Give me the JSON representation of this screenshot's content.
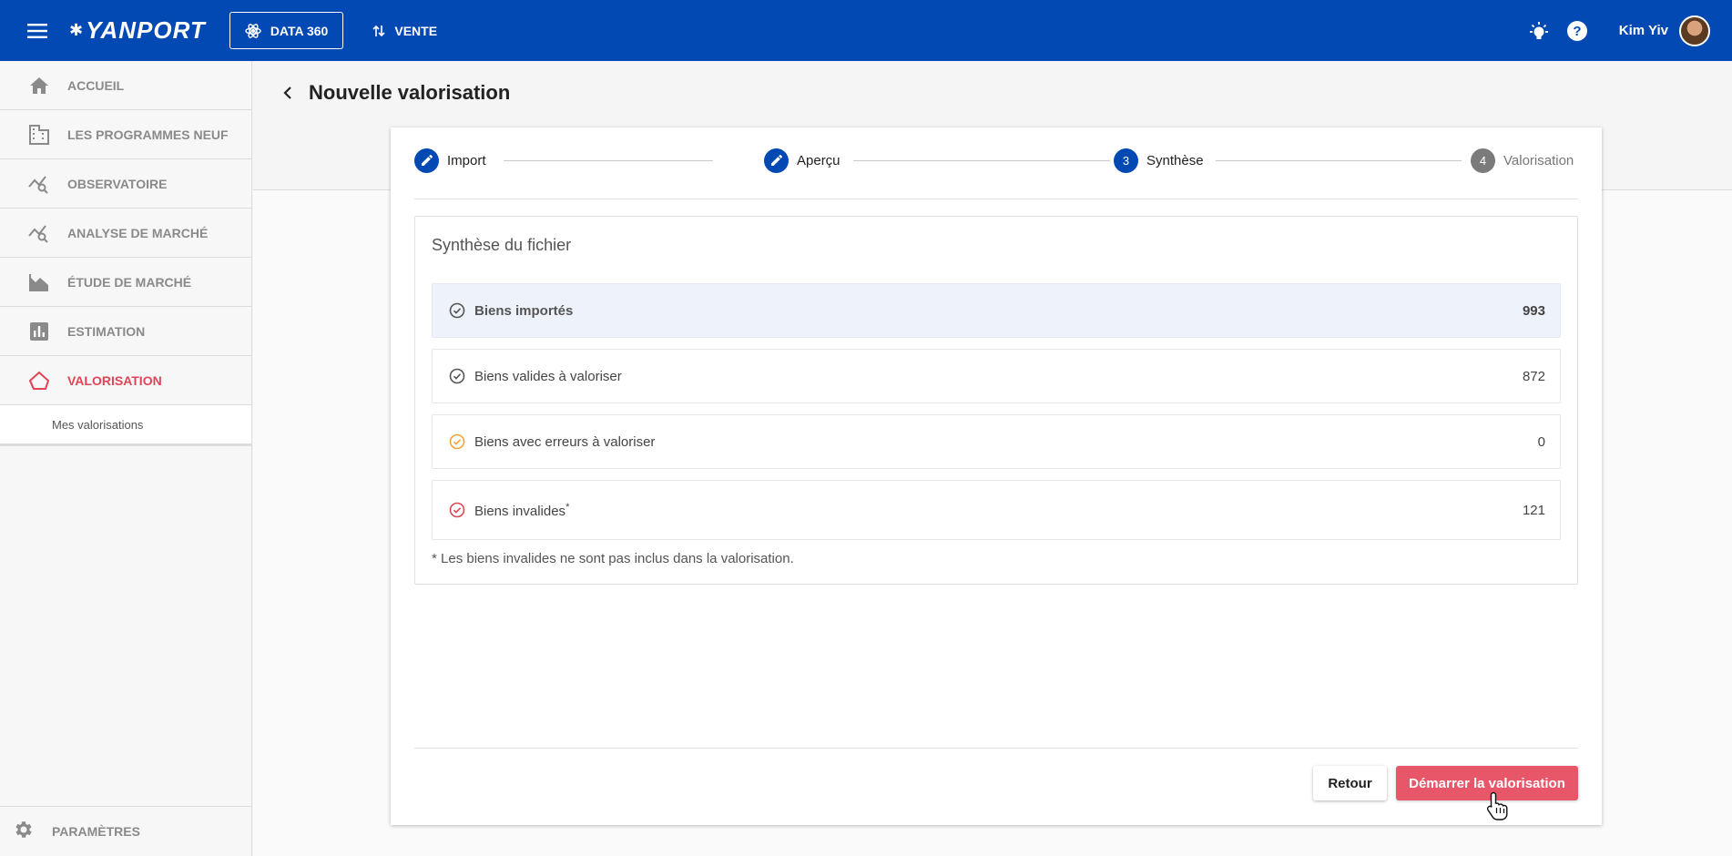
{
  "topbar": {
    "logo_text": "YANPORT",
    "data360_label": "DATA 360",
    "vente_label": "VENTE",
    "user_name": "Kim Yiv",
    "bg_color": "#0349b4"
  },
  "sidebar": {
    "items": [
      {
        "label": "ACCUEIL",
        "icon": "home-icon"
      },
      {
        "label": "LES PROGRAMMES NEUF",
        "icon": "building-icon"
      },
      {
        "label": "OBSERVATOIRE",
        "icon": "chart-search-icon"
      },
      {
        "label": "ANALYSE DE MARCHÉ",
        "icon": "chart-search-icon"
      },
      {
        "label": "ÉTUDE DE MARCHÉ",
        "icon": "area-chart-icon"
      },
      {
        "label": "ESTIMATION",
        "icon": "bar-chart-icon"
      },
      {
        "label": "VALORISATION",
        "icon": "house-outline-icon"
      }
    ],
    "sub_item": "Mes valorisations",
    "params_label": "PARAMÈTRES",
    "active_color": "#e04556"
  },
  "page": {
    "title": "Nouvelle valorisation"
  },
  "stepper": {
    "steps": [
      {
        "label": "Import",
        "marker": "pencil-icon"
      },
      {
        "label": "Aperçu",
        "marker": "pencil-icon"
      },
      {
        "label": "Synthèse",
        "marker": "3"
      },
      {
        "label": "Valorisation",
        "marker": "4"
      }
    ]
  },
  "synthese": {
    "title": "Synthèse du fichier",
    "rows": [
      {
        "label": "Biens importés",
        "value": "993",
        "icon": "check-circle-icon",
        "icon_color": "#555555"
      },
      {
        "label": "Biens valides à valoriser",
        "value": "872",
        "icon": "check-circle-icon",
        "icon_color": "#555555"
      },
      {
        "label": "Biens avec erreurs à valoriser",
        "value": "0",
        "icon": "check-circle-icon",
        "icon_color": "#f0a53a"
      },
      {
        "label": "Biens invalides",
        "sup": "*",
        "value": "121",
        "icon": "check-circle-icon",
        "icon_color": "#e04556"
      }
    ],
    "footnote": "* Les biens invalides ne sont pas inclus dans la valorisation."
  },
  "actions": {
    "back_label": "Retour",
    "start_label": "Démarrer la valorisation",
    "start_color": "#e8566a"
  }
}
